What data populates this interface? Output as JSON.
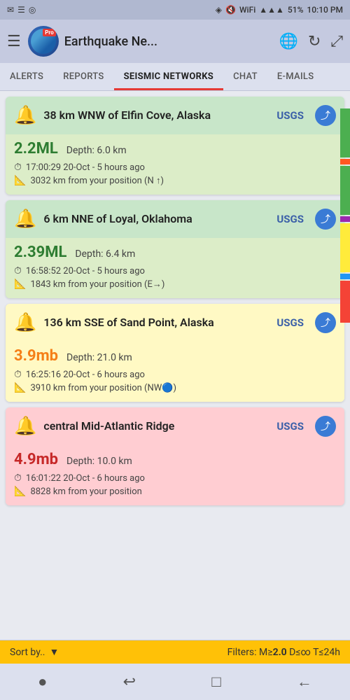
{
  "statusBar": {
    "leftIcons": [
      "✉",
      "☰",
      "◎"
    ],
    "battery": "51%",
    "time": "10:10 PM",
    "signal": "▲▲▲",
    "wifi": "WiFi"
  },
  "header": {
    "title": "Earthquake Ne...",
    "menuIcon": "☰",
    "globeIcon": "🌐",
    "refreshIcon": "↻",
    "expandIcon": "⤢"
  },
  "tabs": [
    {
      "id": "alerts",
      "label": "ALERTS",
      "active": false
    },
    {
      "id": "reports",
      "label": "REPORTS",
      "active": false
    },
    {
      "id": "seismic",
      "label": "SEISMIC NETWORKS",
      "active": true
    },
    {
      "id": "chat",
      "label": "CHAT",
      "active": false
    },
    {
      "id": "emails",
      "label": "E-MAILS",
      "active": false
    }
  ],
  "earthquakes": [
    {
      "id": "eq1",
      "location": "38 km WNW of Elfin Cove, Alaska",
      "source": "USGS",
      "magnitude": "2.2ML",
      "magType": "green",
      "depth": "Depth: 6.0 km",
      "time": "17:00:29 20-Oct - 5 hours ago",
      "distance": "3032 km from your position (N ↑)",
      "cardColor": "green",
      "icon": "🔔"
    },
    {
      "id": "eq2",
      "location": "6 km NNE of Loyal, Oklahoma",
      "source": "USGS",
      "magnitude": "2.39ML",
      "magType": "green",
      "depth": "Depth: 6.4 km",
      "time": "16:58:52 20-Oct - 5 hours ago",
      "distance": "1843 km from your position (E→)",
      "cardColor": "green",
      "icon": "🔔"
    },
    {
      "id": "eq3",
      "location": "136 km SSE of Sand Point, Alaska",
      "source": "USGS",
      "magnitude": "3.9mb",
      "magType": "yellow",
      "depth": "Depth: 21.0 km",
      "time": "16:25:16 20-Oct - 6 hours ago",
      "distance": "3910 km from your position (NW🔵)",
      "cardColor": "yellow",
      "icon": "🔔"
    },
    {
      "id": "eq4",
      "location": "central Mid-Atlantic Ridge",
      "source": "USGS",
      "magnitude": "4.9mb",
      "magType": "red",
      "depth": "Depth: 10.0 km",
      "time": "16:01:22 20-Oct - 6 hours ago",
      "distance": "8828 km from your position",
      "cardColor": "red",
      "icon": "🔔"
    }
  ],
  "bottomBar": {
    "sortLabel": "Sort by..",
    "filterText": "Filters: M≥",
    "filterMag": "2.0",
    "filterDist": " D≤∞ T≤24h"
  },
  "navBar": {
    "icons": [
      "●",
      "↩",
      "□",
      "←"
    ]
  }
}
